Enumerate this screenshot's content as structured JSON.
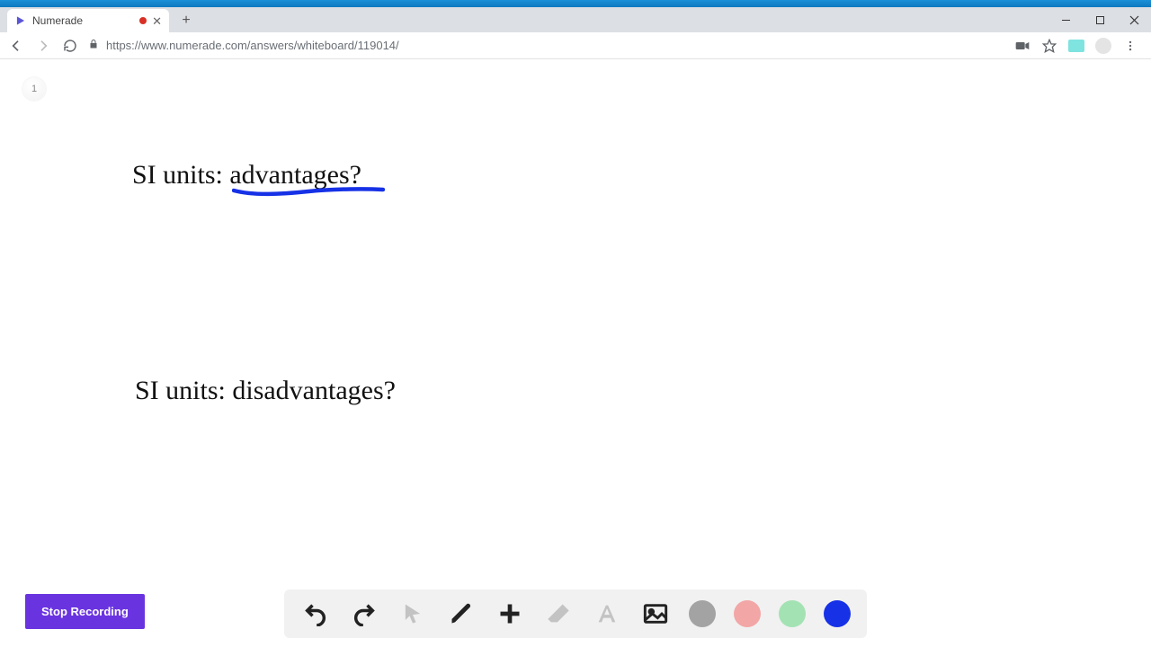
{
  "browser": {
    "tab_title": "Numerade",
    "url": "https://www.numerade.com/answers/whiteboard/119014/"
  },
  "page_badge": "1",
  "whiteboard": {
    "text1": "SI units: advantages?",
    "text2": "SI units: disadvantages?",
    "underline_color": "#1631e6"
  },
  "controls": {
    "stop_recording_label": "Stop Recording"
  },
  "toolbar": {
    "undo": "undo",
    "redo": "redo",
    "pointer": "pointer",
    "pen": "pen",
    "add": "add",
    "eraser": "eraser",
    "text": "text",
    "image": "image",
    "swatches": {
      "gray": "#a3a3a3",
      "pink": "#f2a6a6",
      "green": "#a3e2b3",
      "blue": "#1631e6"
    }
  }
}
